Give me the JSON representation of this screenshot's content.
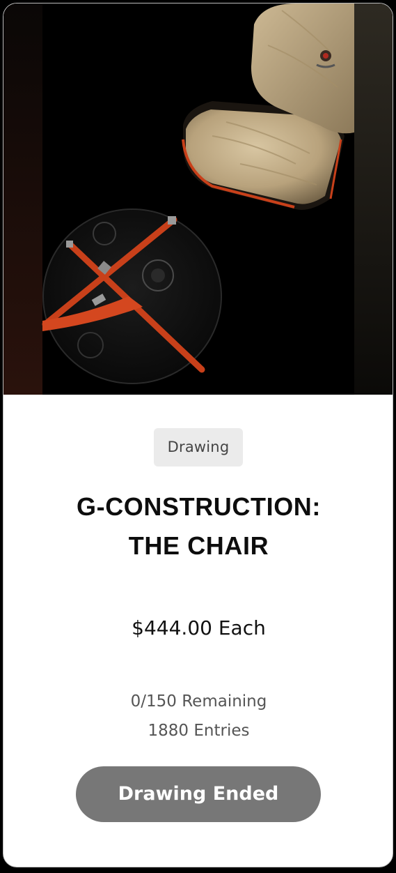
{
  "product": {
    "image_alt": "Top-down view of a beige upholstered chair and a round black table with orange straps",
    "badge": "Drawing",
    "title_line1": "G-CONSTRUCTION:",
    "title_line2": "THE CHAIR",
    "price": "$444.00 Each",
    "remaining": "0/150 Remaining",
    "entries": "1880 Entries",
    "cta_label": "Drawing Ended"
  },
  "colors": {
    "page_background": "#000000",
    "card_background": "#ffffff",
    "badge_background": "#ebebeb",
    "button_background": "#777777",
    "accent_orange": "#c8401a"
  }
}
